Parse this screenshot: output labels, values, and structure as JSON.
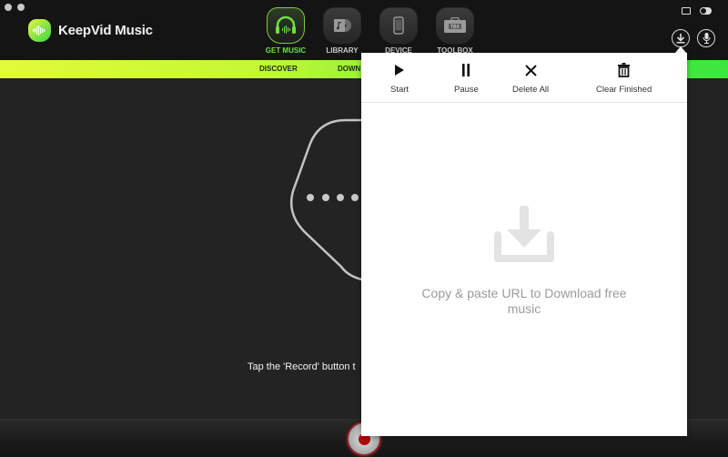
{
  "app": {
    "title": "KeepVid Music"
  },
  "window_controls": [
    "close",
    "minimize"
  ],
  "main_nav": [
    {
      "label": "GET MUSIC",
      "icon": "headphones-icon",
      "active": true
    },
    {
      "label": "LIBRARY",
      "icon": "library-icon",
      "active": false
    },
    {
      "label": "DEVICE",
      "icon": "phone-icon",
      "active": false
    },
    {
      "label": "TOOLBOX",
      "icon": "toolbox-icon",
      "active": false
    }
  ],
  "toolbox_badge": "TBX",
  "top_right": {
    "icons": [
      "message-icon",
      "toggle-icon"
    ],
    "download_button": "download-icon",
    "record_button": "microphone-icon"
  },
  "sub_nav": {
    "tabs": [
      "DISCOVER",
      "DOWN"
    ]
  },
  "main": {
    "dots": 4,
    "instruction": "Tap the 'Record' button t"
  },
  "download_popover": {
    "toolbar": [
      {
        "label": "Start",
        "icon": "play-icon"
      },
      {
        "label": "Pause",
        "icon": "pause-icon"
      },
      {
        "label": "Delete All",
        "icon": "close-icon"
      },
      {
        "label": "Clear Finished",
        "icon": "trash-icon"
      }
    ],
    "empty_state": {
      "icon": "download-tray-icon",
      "text": "Copy & paste URL to Download free music"
    }
  },
  "colors": {
    "accent_green": "#6be33b",
    "subnav_start": "#e2fb38",
    "subnav_end": "#3ce63f",
    "record_red": "#b00d0d"
  }
}
